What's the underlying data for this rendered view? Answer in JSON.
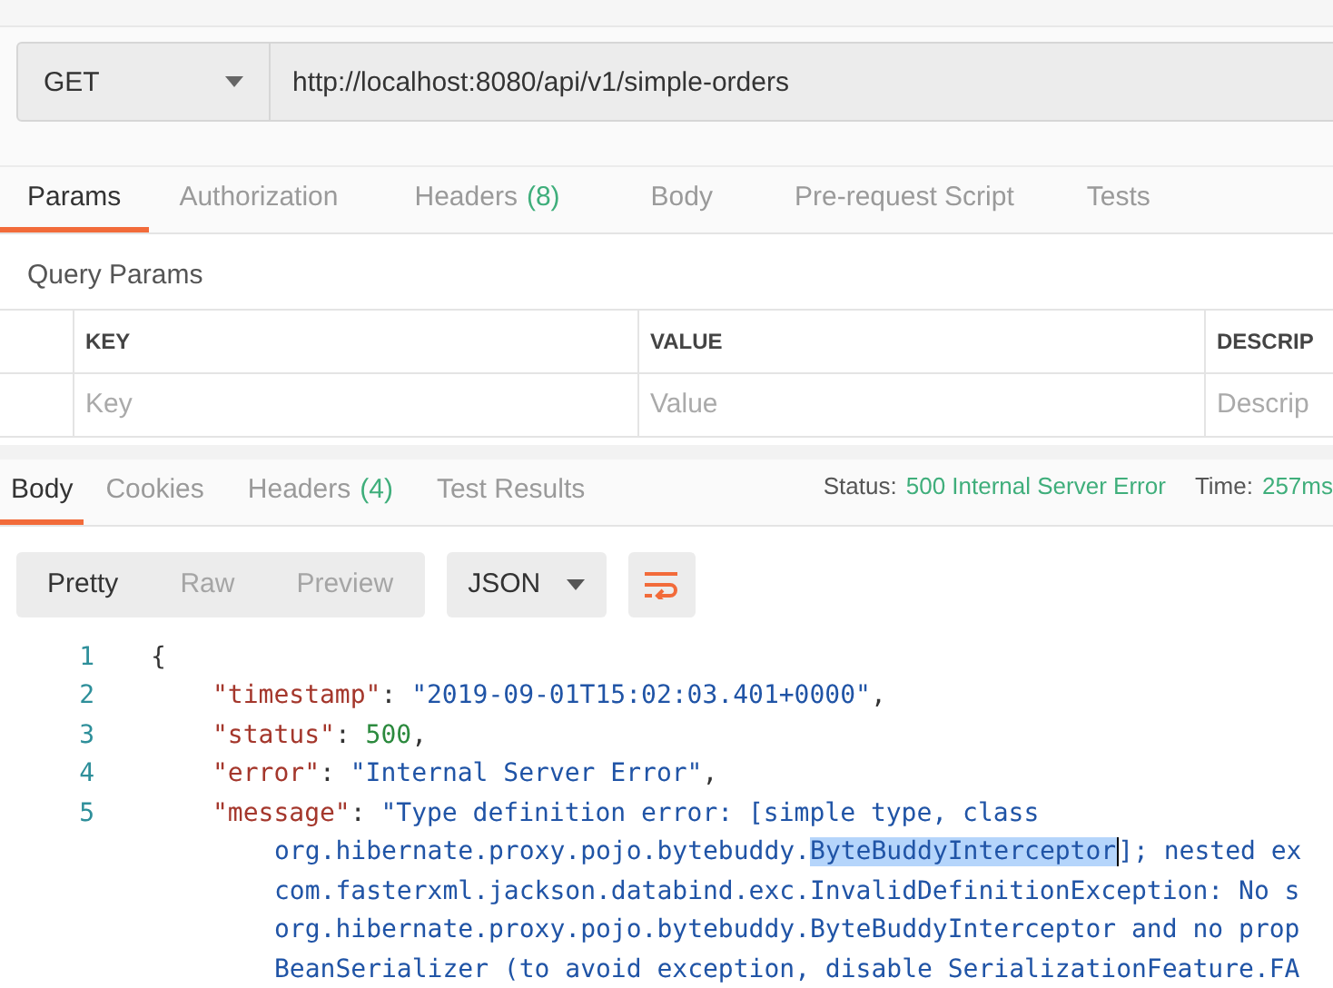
{
  "request": {
    "method": "GET",
    "url": "http://localhost:8080/api/v1/simple-orders"
  },
  "request_tabs": [
    {
      "label": "Params",
      "selected": true
    },
    {
      "label": "Authorization",
      "selected": false
    },
    {
      "label": "Headers",
      "count": "(8)",
      "selected": false
    },
    {
      "label": "Body",
      "selected": false
    },
    {
      "label": "Pre-request Script",
      "selected": false
    },
    {
      "label": "Tests",
      "selected": false
    }
  ],
  "query_params": {
    "title": "Query Params",
    "columns": [
      "KEY",
      "VALUE",
      "DESCRIP"
    ],
    "placeholders": [
      "Key",
      "Value",
      "Descrip"
    ]
  },
  "response_tabs": [
    {
      "label": "Body",
      "selected": true
    },
    {
      "label": "Cookies",
      "selected": false
    },
    {
      "label": "Headers",
      "count": "(4)",
      "selected": false
    },
    {
      "label": "Test Results",
      "selected": false
    }
  ],
  "response_status": [
    {
      "label": "Status:",
      "value": "500 Internal Server Error"
    },
    {
      "label": "Time:",
      "value": "257ms"
    }
  ],
  "view_modes": [
    {
      "label": "Pretty",
      "selected": true
    },
    {
      "label": "Raw",
      "selected": false
    },
    {
      "label": "Preview",
      "selected": false
    }
  ],
  "format": "JSON",
  "code_lines": [
    {
      "number": "1",
      "tokens": [
        {
          "kind": "punct",
          "text": "{"
        }
      ],
      "children": [
        {
          "number": "2",
          "tokens": [
            {
              "kind": "key",
              "text": "\"timestamp\""
            },
            {
              "kind": "punct",
              "text": ": "
            },
            {
              "kind": "string",
              "text": "\"2019-09-01T15:02:03.401+0000\""
            },
            {
              "kind": "punct",
              "text": ","
            }
          ]
        },
        {
          "number": "3",
          "tokens": [
            {
              "kind": "key",
              "text": "\"status\""
            },
            {
              "kind": "punct",
              "text": ": "
            },
            {
              "kind": "number",
              "text": "500"
            },
            {
              "kind": "punct",
              "text": ","
            }
          ]
        },
        {
          "number": "4",
          "tokens": [
            {
              "kind": "key",
              "text": "\"error\""
            },
            {
              "kind": "punct",
              "text": ": "
            },
            {
              "kind": "string",
              "text": "\"Internal Server Error\""
            },
            {
              "kind": "punct",
              "text": ","
            }
          ]
        },
        {
          "number": "5",
          "tokens": [
            {
              "kind": "key",
              "text": "\"message\""
            },
            {
              "kind": "punct",
              "text": ": "
            },
            {
              "kind": "string",
              "text": "\"Type definition error: [simple type, class"
            }
          ],
          "children": [
            {
              "tokens": [
                {
                  "kind": "string",
                  "text": "org.hibernate.proxy.pojo.bytebuddy."
                },
                {
                  "kind": "selected",
                  "text": "ByteBuddyInterceptor"
                },
                {
                  "kind": "string",
                  "text": "]; nested ex"
                }
              ]
            },
            {
              "tokens": [
                {
                  "kind": "string",
                  "text": "com.fasterxml.jackson.databind.exc.InvalidDefinitionException: No s"
                }
              ]
            },
            {
              "tokens": [
                {
                  "kind": "string",
                  "text": "org.hibernate.proxy.pojo.bytebuddy.ByteBuddyInterceptor and no prop"
                }
              ]
            },
            {
              "tokens": [
                {
                  "kind": "string",
                  "text": "BeanSerializer (to avoid exception, disable SerializationFeature.FA"
                }
              ]
            }
          ]
        }
      ]
    }
  ]
}
